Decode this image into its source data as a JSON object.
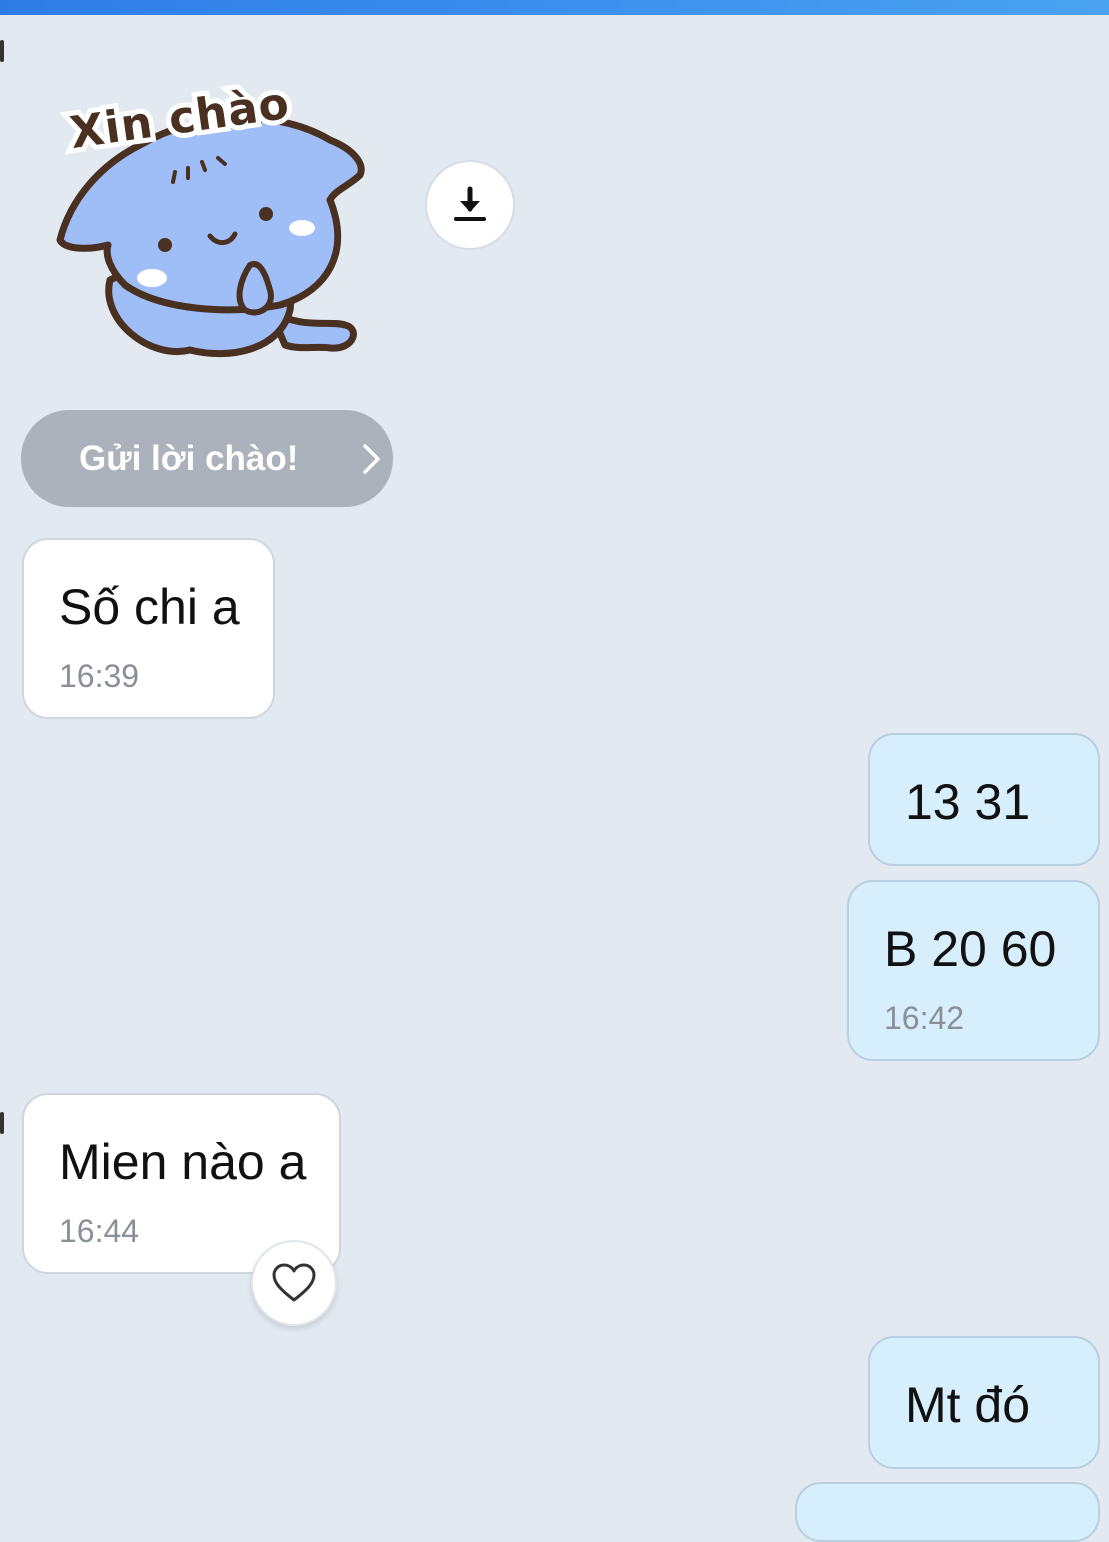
{
  "sticker": {
    "text": "Xin chào"
  },
  "greet_button": {
    "label": "Gửi lời chào!"
  },
  "messages": [
    {
      "direction": "in",
      "text": "Số chi a",
      "time": "16:39"
    },
    {
      "direction": "out",
      "text": "13 31",
      "time": ""
    },
    {
      "direction": "out",
      "text": "B 20 60",
      "time": "16:42"
    },
    {
      "direction": "in",
      "text": "Mien nào a",
      "time": "16:44"
    },
    {
      "direction": "out",
      "text": "Mt đó",
      "time": ""
    }
  ],
  "icons": {
    "download": "download-icon",
    "chevron": "chevron-right-icon",
    "heart": "heart-icon"
  },
  "colors": {
    "background": "#e2e9f1",
    "incoming_bubble": "#ffffff",
    "outgoing_bubble": "#d7eefc",
    "greet_button": "#abb2bb",
    "top_bar": "#3b8fee"
  }
}
